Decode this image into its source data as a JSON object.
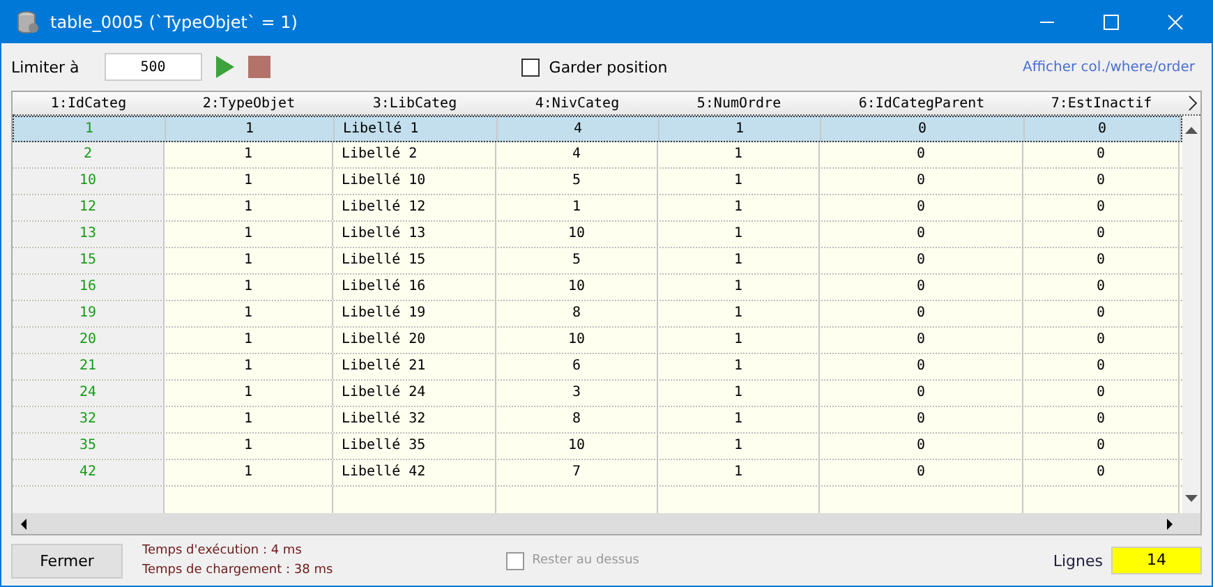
{
  "window": {
    "title": "table_0005 (`TypeObjet` = 1)"
  },
  "toolbar": {
    "limit_label": "Limiter à",
    "limit_value": "500",
    "keep_position": {
      "label": "Garder position",
      "checked": false
    },
    "link": "Afficher col./where/order"
  },
  "table": {
    "columns": [
      "1:IdCateg",
      "2:TypeObjet",
      "3:LibCateg",
      "4:NivCateg",
      "5:NumOrdre",
      "6:IdCategParent",
      "7:EstInactif"
    ],
    "rows": [
      {
        "cells": [
          "1",
          "1",
          "Libellé 1",
          "4",
          "1",
          "0",
          "0"
        ],
        "selected": true
      },
      {
        "cells": [
          "2",
          "1",
          "Libellé 2",
          "4",
          "1",
          "0",
          "0"
        ],
        "selected": false
      },
      {
        "cells": [
          "10",
          "1",
          "Libellé 10",
          "5",
          "1",
          "0",
          "0"
        ],
        "selected": false
      },
      {
        "cells": [
          "12",
          "1",
          "Libellé 12",
          "1",
          "1",
          "0",
          "0"
        ],
        "selected": false
      },
      {
        "cells": [
          "13",
          "1",
          "Libellé 13",
          "10",
          "1",
          "0",
          "0"
        ],
        "selected": false
      },
      {
        "cells": [
          "15",
          "1",
          "Libellé 15",
          "5",
          "1",
          "0",
          "0"
        ],
        "selected": false
      },
      {
        "cells": [
          "16",
          "1",
          "Libellé 16",
          "10",
          "1",
          "0",
          "0"
        ],
        "selected": false
      },
      {
        "cells": [
          "19",
          "1",
          "Libellé 19",
          "8",
          "1",
          "0",
          "0"
        ],
        "selected": false
      },
      {
        "cells": [
          "20",
          "1",
          "Libellé 20",
          "10",
          "1",
          "0",
          "0"
        ],
        "selected": false
      },
      {
        "cells": [
          "21",
          "1",
          "Libellé 21",
          "6",
          "1",
          "0",
          "0"
        ],
        "selected": false
      },
      {
        "cells": [
          "24",
          "1",
          "Libellé 24",
          "3",
          "1",
          "0",
          "0"
        ],
        "selected": false
      },
      {
        "cells": [
          "32",
          "1",
          "Libellé 32",
          "8",
          "1",
          "0",
          "0"
        ],
        "selected": false
      },
      {
        "cells": [
          "35",
          "1",
          "Libellé 35",
          "10",
          "1",
          "0",
          "0"
        ],
        "selected": false
      },
      {
        "cells": [
          "42",
          "1",
          "Libellé 42",
          "7",
          "1",
          "0",
          "0"
        ],
        "selected": false
      }
    ]
  },
  "footer": {
    "close_button": "Fermer",
    "exec_time": "Temps d'exécution : 4 ms",
    "load_time": "Temps de chargement : 38 ms",
    "stay_on_top": {
      "label": "Rester au dessus",
      "checked": false,
      "disabled": true
    },
    "rows_label": "Lignes",
    "rows_count": "14"
  }
}
